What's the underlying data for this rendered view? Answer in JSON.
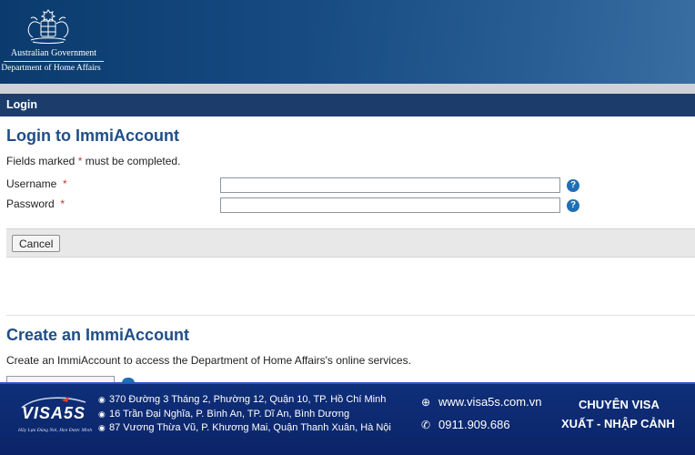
{
  "header": {
    "gov_name": "Australian Government",
    "department": "Department of Home Affairs"
  },
  "nav": {
    "login_tab": "Login"
  },
  "login": {
    "title": "Login to ImmiAccount",
    "fields_note_prefix": "Fields marked ",
    "required_marker": "*",
    "fields_note_suffix": " must be completed.",
    "username_label": "Username",
    "username_value": "",
    "password_label": "Password",
    "password_value": "",
    "help_glyph": "?",
    "cancel_label": "Cancel"
  },
  "create": {
    "title": "Create an ImmiAccount",
    "description": "Create an ImmiAccount to access the Department of Home Affairs's online services."
  },
  "banner": {
    "logo": "VISA5S",
    "tagline": "Hãy Lựa Đúng Nơi, Hẹn Được Mình",
    "addresses": [
      "370 Đường 3 Tháng 2, Phường 12, Quận 10, TP. Hồ Chí Minh",
      "16 Trần Đại Nghĩa, P. Bình An, TP. Dĩ An, Bình Dương",
      "87 Vương Thừa Vũ, P. Khương Mai, Quận Thanh Xuân, Hà Nội"
    ],
    "website": "www.visa5s.com.vn",
    "phone": "0911.909.686",
    "slogan_line1": "CHUYÊN VISA",
    "slogan_line2": "XUẤT - NHẬP CẢNH"
  },
  "colors": {
    "header_blue": "#174b82",
    "login_bar": "#1c3d6b",
    "title_blue": "#1f4e87",
    "required_red": "#c0392b",
    "help_blue": "#1f6fb5",
    "banner_navy": "#0f2f7a"
  },
  "icons": {
    "crest": "coat-of-arms-icon",
    "help": "help-question-icon",
    "pin": "location-pin-icon",
    "globe": "globe-icon",
    "phone": "phone-icon"
  }
}
